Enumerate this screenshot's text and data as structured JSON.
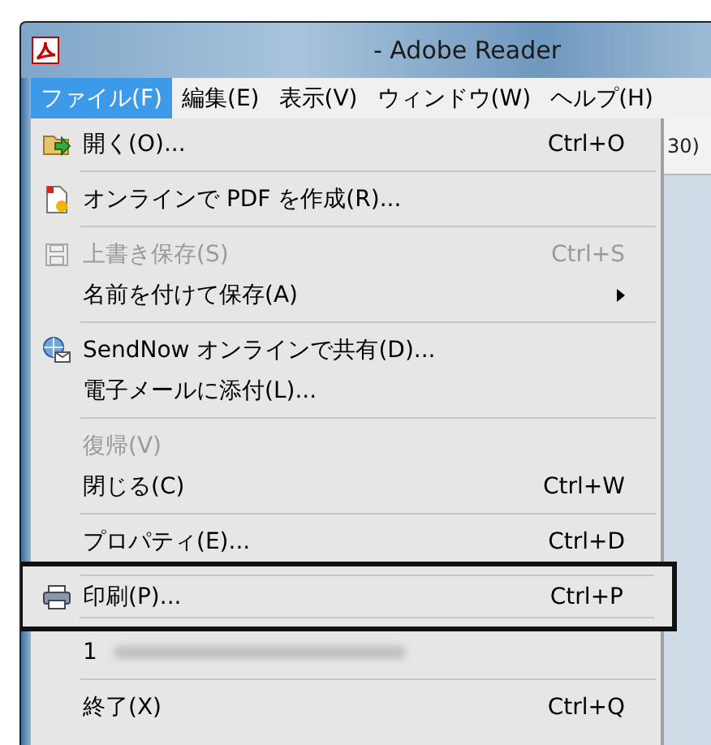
{
  "window": {
    "title": "- Adobe Reader"
  },
  "menu_bar": [
    {
      "label": "ファイル(F)",
      "selected": true
    },
    {
      "label": "編集(E)",
      "selected": false
    },
    {
      "label": "表示(V)",
      "selected": false
    },
    {
      "label": "ウィンドウ(W)",
      "selected": false
    },
    {
      "label": "ヘルプ(H)",
      "selected": false
    }
  ],
  "toolbar": {
    "text": "30)"
  },
  "file_menu": [
    {
      "kind": "item",
      "label": "開く(O)...",
      "shortcut": "Ctrl+O",
      "disabled": false,
      "icon": true
    },
    {
      "kind": "separator"
    },
    {
      "kind": "item",
      "label": "オンラインで PDF を作成(R)...",
      "disabled": false,
      "icon": true
    },
    {
      "kind": "separator"
    },
    {
      "kind": "item",
      "label": "上書き保存(S)",
      "shortcut": "Ctrl+S",
      "disabled": true,
      "icon": true
    },
    {
      "kind": "submenu",
      "label": "名前を付けて保存(A)",
      "disabled": false
    },
    {
      "kind": "separator"
    },
    {
      "kind": "item",
      "label": "SendNow オンラインで共有(D)...",
      "disabled": false,
      "icon": true
    },
    {
      "kind": "item",
      "label": "電子メールに添付(L)...",
      "disabled": false
    },
    {
      "kind": "separator"
    },
    {
      "kind": "item",
      "label": "復帰(V)",
      "disabled": true
    },
    {
      "kind": "item",
      "label": "閉じる(C)",
      "shortcut": "Ctrl+W",
      "disabled": false
    },
    {
      "kind": "separator"
    },
    {
      "kind": "item",
      "label": "プロパティ(E)...",
      "shortcut": "Ctrl+D",
      "disabled": false
    },
    {
      "kind": "item",
      "label": "印刷(P)...",
      "shortcut": "Ctrl+P",
      "disabled": false,
      "icon": true,
      "callout": true
    },
    {
      "kind": "recent",
      "label": "1"
    },
    {
      "kind": "separator"
    },
    {
      "kind": "item",
      "label": "終了(X)",
      "shortcut": "Ctrl+Q",
      "disabled": false
    }
  ]
}
